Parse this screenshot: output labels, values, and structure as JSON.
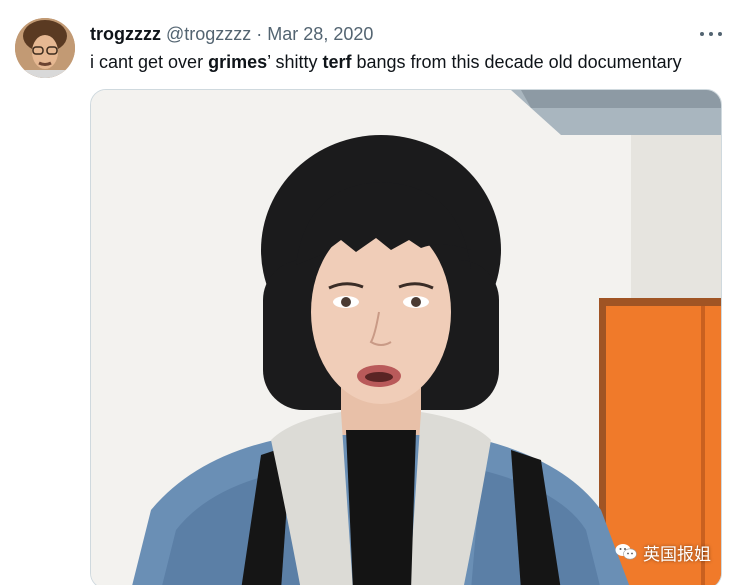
{
  "tweet": {
    "display_name": "trogzzzz",
    "handle": "@trogzzzz",
    "separator": "·",
    "date": "Mar 28, 2020",
    "text_parts": {
      "p1": "i cant get over ",
      "b1": "grimes",
      "p2": "’ shitty ",
      "b2": "terf",
      "p3": " bangs from this decade old documentary"
    }
  },
  "icons": {
    "more": "more-horizontal-icon",
    "watermark": "wechat-icon"
  },
  "watermark": {
    "text": "英国报姐"
  },
  "colors": {
    "text_primary": "#0f1419",
    "text_secondary": "#536471",
    "border": "#cfd9de",
    "door_orange": "#f07a2a"
  }
}
